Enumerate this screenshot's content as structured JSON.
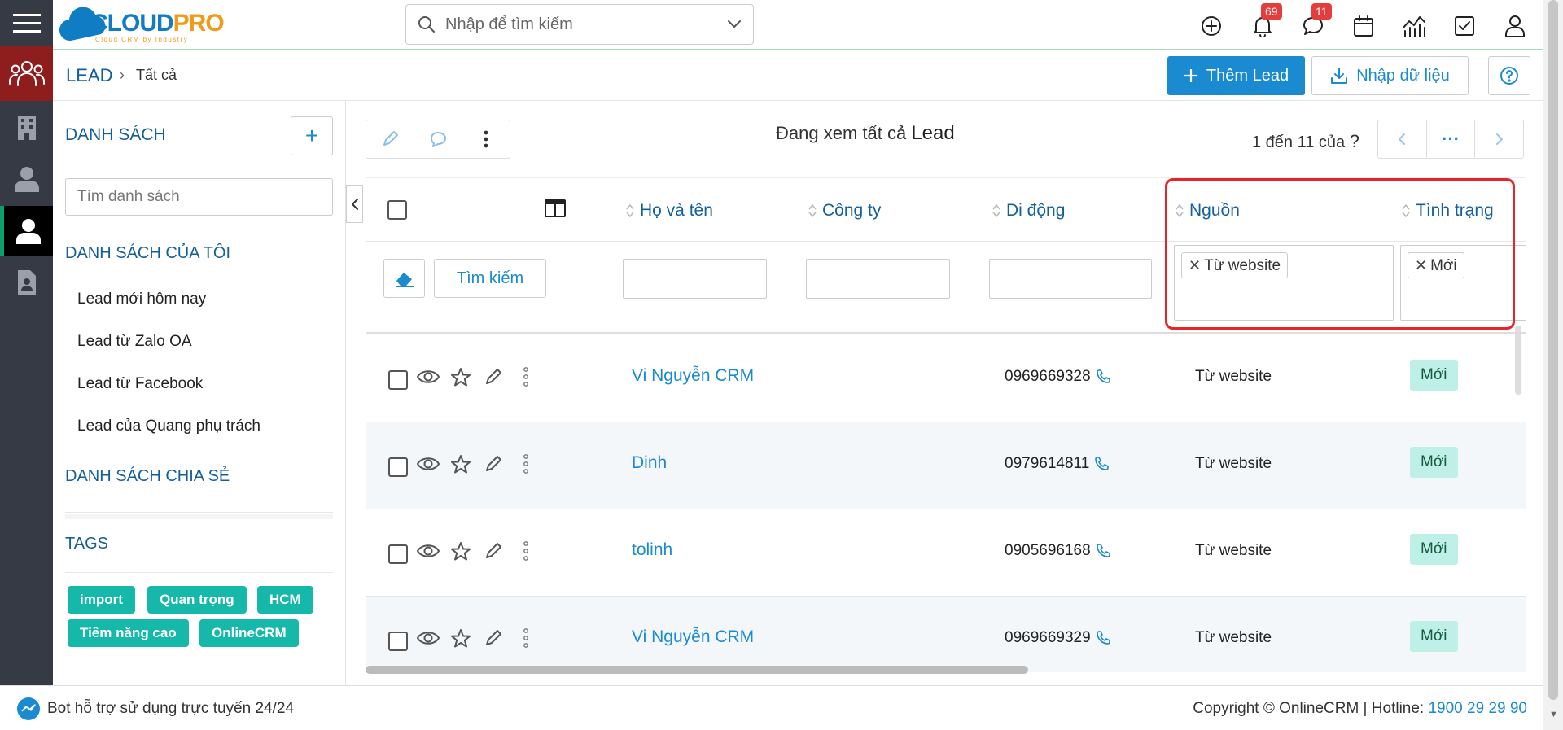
{
  "topbar": {
    "logo_main": "CLOUD",
    "logo_accent": "PRO",
    "logo_tagline": "Cloud CRM by Industry",
    "search_placeholder": "Nhập để tìm kiếm",
    "notifications_count": "69",
    "messages_count": "11"
  },
  "breadcrumb": {
    "module": "LEAD",
    "separator": "›",
    "current": "Tất cả"
  },
  "header_actions": {
    "add_label": "Thêm Lead",
    "import_label": "Nhập dữ liệu"
  },
  "sidebar": {
    "title": "DANH SÁCH",
    "search_placeholder": "Tìm danh sách",
    "my_lists_title": "DANH SÁCH CỦA TÔI",
    "my_lists": [
      "Lead mới hôm nay",
      "Lead từ Zalo OA",
      "Lead từ Facebook",
      "Lead của Quang phụ trách"
    ],
    "shared_title": "DANH SÁCH CHIA SẺ",
    "tags_title": "TAGS",
    "tags": [
      "import",
      "Quan trọng",
      "HCM",
      "Tiềm năng cao",
      "OnlineCRM"
    ]
  },
  "main": {
    "viewing_prefix": "Đang xem tất cả",
    "viewing_module": "Lead",
    "paging_text": "1 đến 11 của",
    "paging_unknown": "?",
    "pager_more": "···"
  },
  "table": {
    "columns": [
      "Họ và tên",
      "Công ty",
      "Di động",
      "Nguồn",
      "Tình trạng"
    ],
    "search_button": "Tìm kiếm",
    "filters": {
      "source": "Từ website",
      "status": "Mới"
    },
    "rows": [
      {
        "name": "Vi Nguyễn CRM",
        "company": "",
        "mobile": "0969669328",
        "source": "Từ website",
        "status": "Mới"
      },
      {
        "name": "Dinh",
        "company": "",
        "mobile": "0979614811",
        "source": "Từ website",
        "status": "Mới"
      },
      {
        "name": "tolinh",
        "company": "",
        "mobile": "0905696168",
        "source": "Từ website",
        "status": "Mới"
      },
      {
        "name": "Vi Nguyễn CRM",
        "company": "",
        "mobile": "0969669329",
        "source": "Từ website",
        "status": "Mới"
      }
    ]
  },
  "footer": {
    "bot_text": "Bot hỗ trợ sử dụng trực tuyến 24/24",
    "copyright": "Copyright © OnlineCRM | Hotline:",
    "hotline": "1900 29 29 90"
  },
  "colors": {
    "primary": "#1a8ad1",
    "rail": "#353a45",
    "leads_module": "#8e1d1d",
    "tag": "#16b8aa",
    "status_bg": "#bff0e7",
    "highlight": "#e5252a"
  }
}
